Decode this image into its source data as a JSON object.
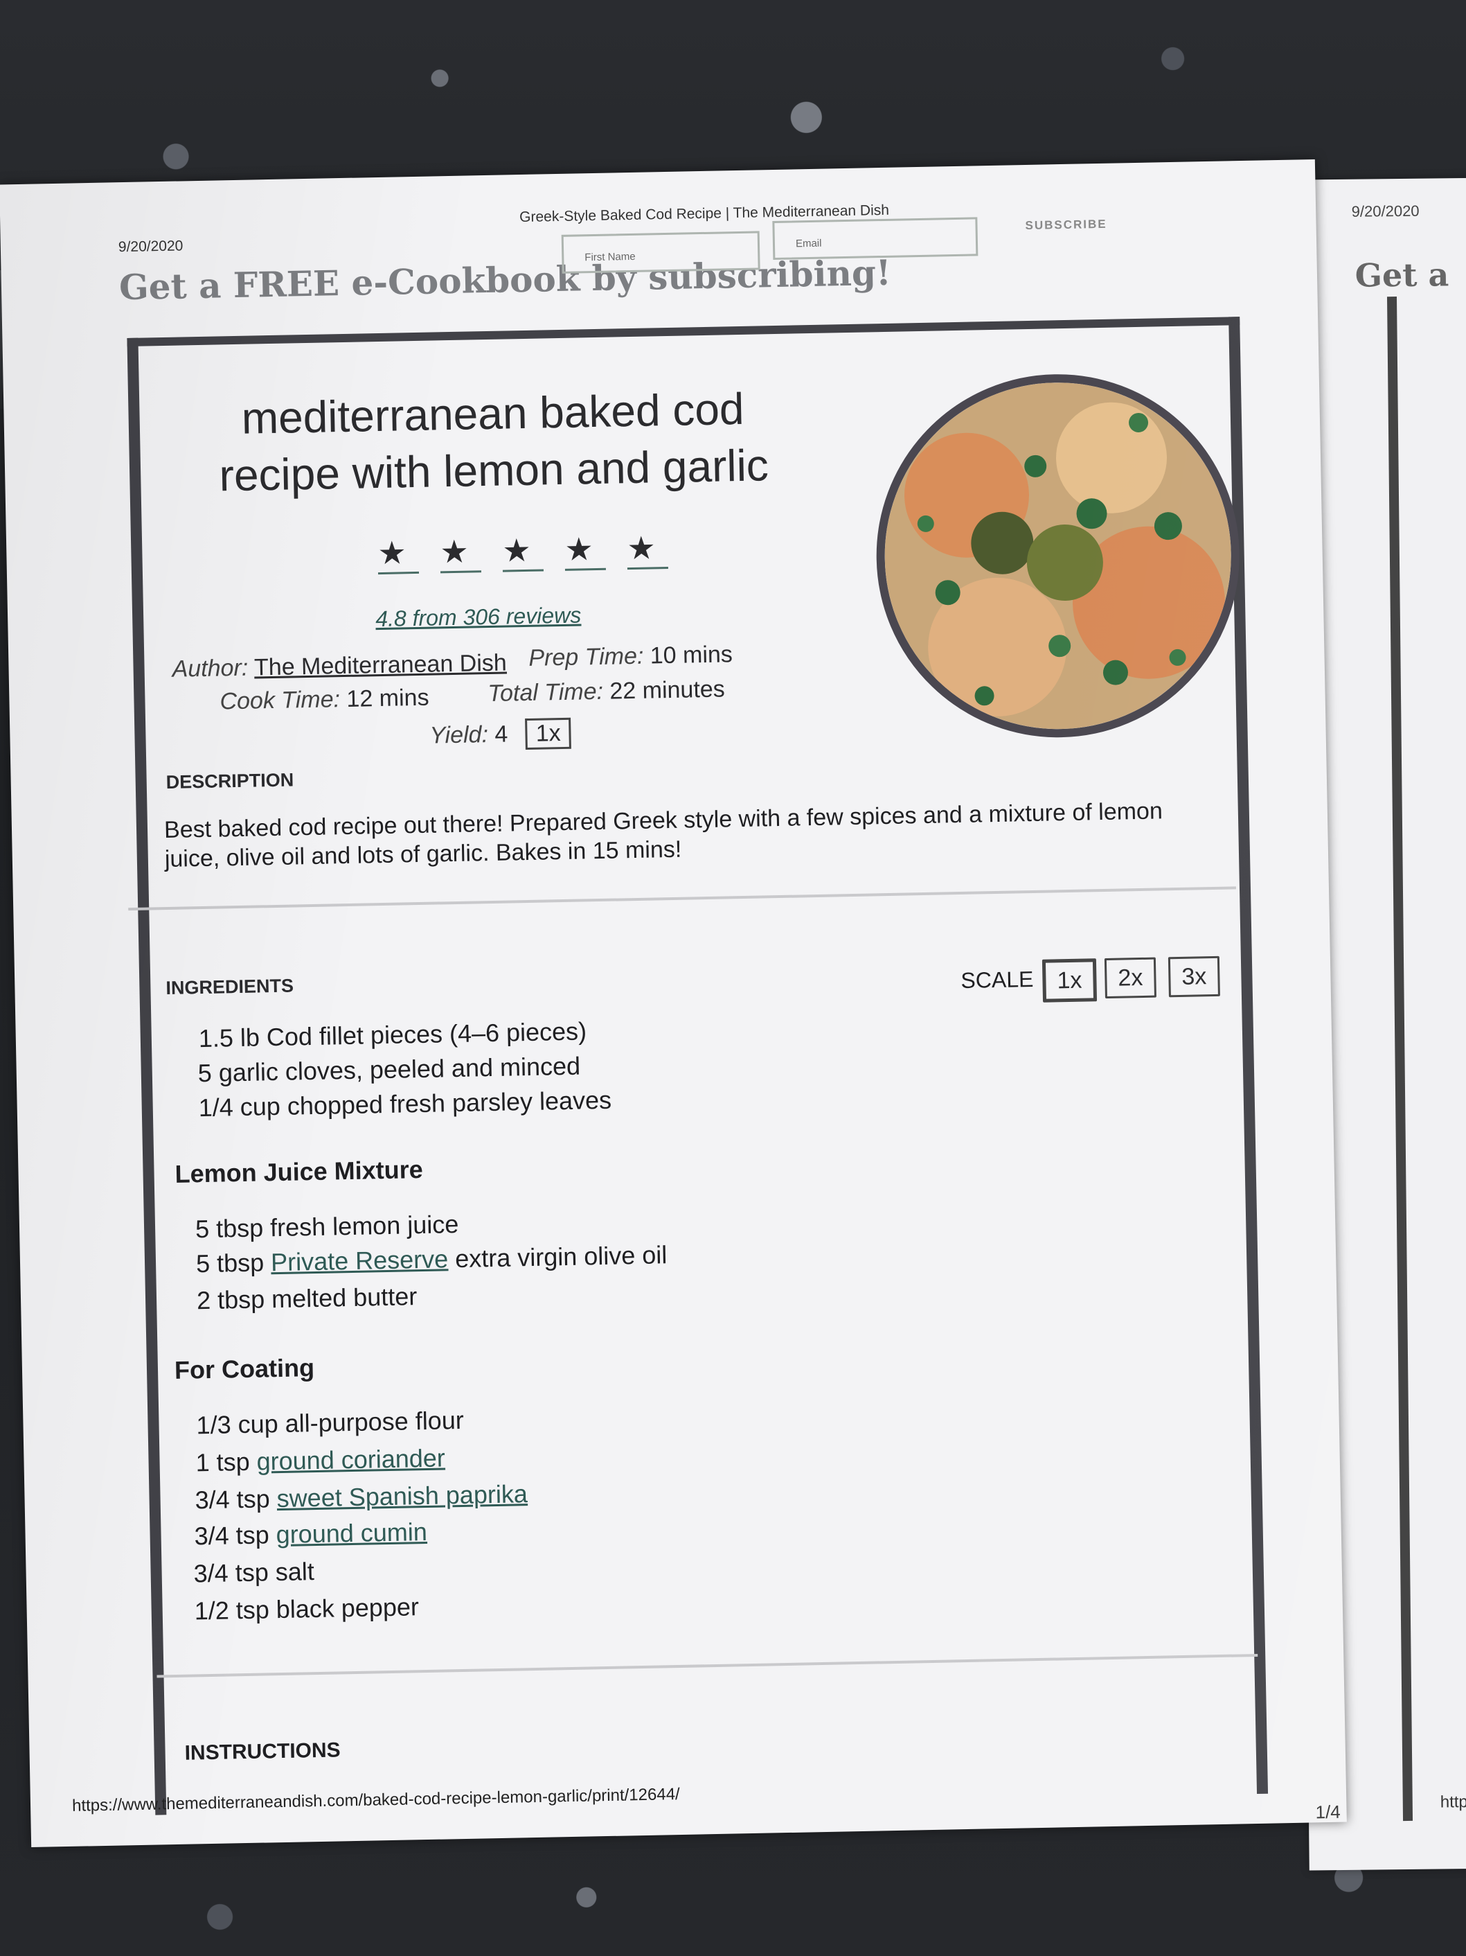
{
  "header": {
    "date": "9/20/2020",
    "page_title": "Greek-Style Baked Cod Recipe | The Mediterranean Dish",
    "first_name_placeholder": "First Name",
    "email_placeholder": "Email",
    "subscribe_label": "SUBSCRIBE",
    "promo": "Get a FREE e-Cookbook by subscribing!"
  },
  "recipe": {
    "title_line1": "mediterranean baked cod",
    "title_line2": "recipe with lemon and garlic",
    "stars": 5,
    "rating_text": "4.8 from 306 reviews",
    "author_label": "Author:",
    "author": "The Mediterranean Dish",
    "prep_label": "Prep Time:",
    "prep": "10 mins",
    "cook_label": "Cook Time:",
    "cook": "12 mins",
    "total_label": "Total Time:",
    "total": "22 minutes",
    "yield_label": "Yield:",
    "yield": "4",
    "yield_scale": "1x",
    "description_label": "DESCRIPTION",
    "description": "Best baked cod recipe out there! Prepared Greek style with a few spices and a mixture of lemon juice, olive oil and lots of garlic. Bakes in 15 mins!",
    "ingredients_label": "INGREDIENTS",
    "scale_label": "SCALE",
    "scale_options": [
      "1x",
      "2x",
      "3x"
    ],
    "ingredients_main": [
      "1.5 lb Cod fillet pieces (4–6 pieces)",
      "5 garlic cloves, peeled and minced",
      "1/4 cup chopped fresh parsley leaves"
    ],
    "lemon_group": "Lemon Juice Mixture",
    "lemon_items": {
      "i1": "5 tbsp fresh lemon juice",
      "i2_pre": "5 tbsp",
      "i2_link": "Private Reserve",
      "i2_post": " extra virgin olive oil",
      "i3": "2 tbsp melted butter"
    },
    "coating_group": "For Coating",
    "coating_items": {
      "c1": "1/3 cup all-purpose flour",
      "c2_pre": "1 tsp ",
      "c2_link": "ground coriander",
      "c3_pre": "3/4 tsp ",
      "c3_link": "sweet Spanish paprika",
      "c4_pre": "3/4 tsp ",
      "c4_link": "ground cumin",
      "c5": "3/4 tsp salt",
      "c6": "1/2 tsp black pepper"
    },
    "instructions_label": "INSTRUCTIONS"
  },
  "footer": {
    "url": "https://www.themediterraneandish.com/baked-cod-recipe-lemon-garlic/print/12644/",
    "page": "1/4"
  },
  "second_page": {
    "date": "9/20/2020",
    "promo": "Get a",
    "url": "http"
  }
}
